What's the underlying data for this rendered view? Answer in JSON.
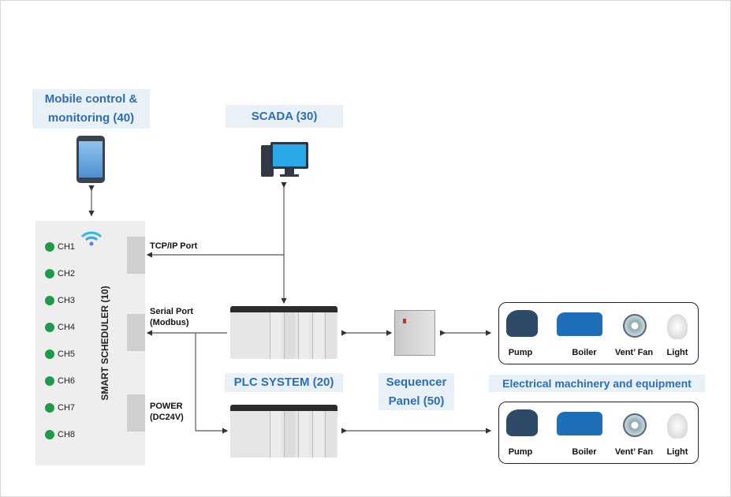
{
  "mobile": {
    "label_line1": "Mobile control &",
    "label_line2": "monitoring (40)",
    "icon": "smartphone-icon"
  },
  "scada": {
    "label": "SCADA (30)",
    "icon": "desktop-computer-icon"
  },
  "scheduler": {
    "title": "SMART SCHEDULER (10)",
    "icon": "wifi-icon",
    "channels": [
      "CH1",
      "CH2",
      "CH3",
      "CH4",
      "CH5",
      "CH6",
      "CH7",
      "CH8"
    ],
    "channel_color": "#1f9a4a",
    "ports": {
      "tcp": "TCP/IP Port",
      "serial_line1": "Serial Port",
      "serial_line2": "(Modbus)",
      "power_line1": "POWER",
      "power_line2": "(DC24V)"
    }
  },
  "plc": {
    "label": "PLC SYSTEM (20)"
  },
  "sequencer": {
    "label_line1": "Sequencer",
    "label_line2": "Panel (50)"
  },
  "equipment": {
    "label": "Electrical machinery and equipment",
    "items": [
      "Pump",
      "Boiler",
      "Vent’ Fan",
      "Light"
    ]
  },
  "colors": {
    "accent": "#2f6db5",
    "label_bg": "#e8f0f8",
    "panel_bg": "#eeeeee"
  }
}
